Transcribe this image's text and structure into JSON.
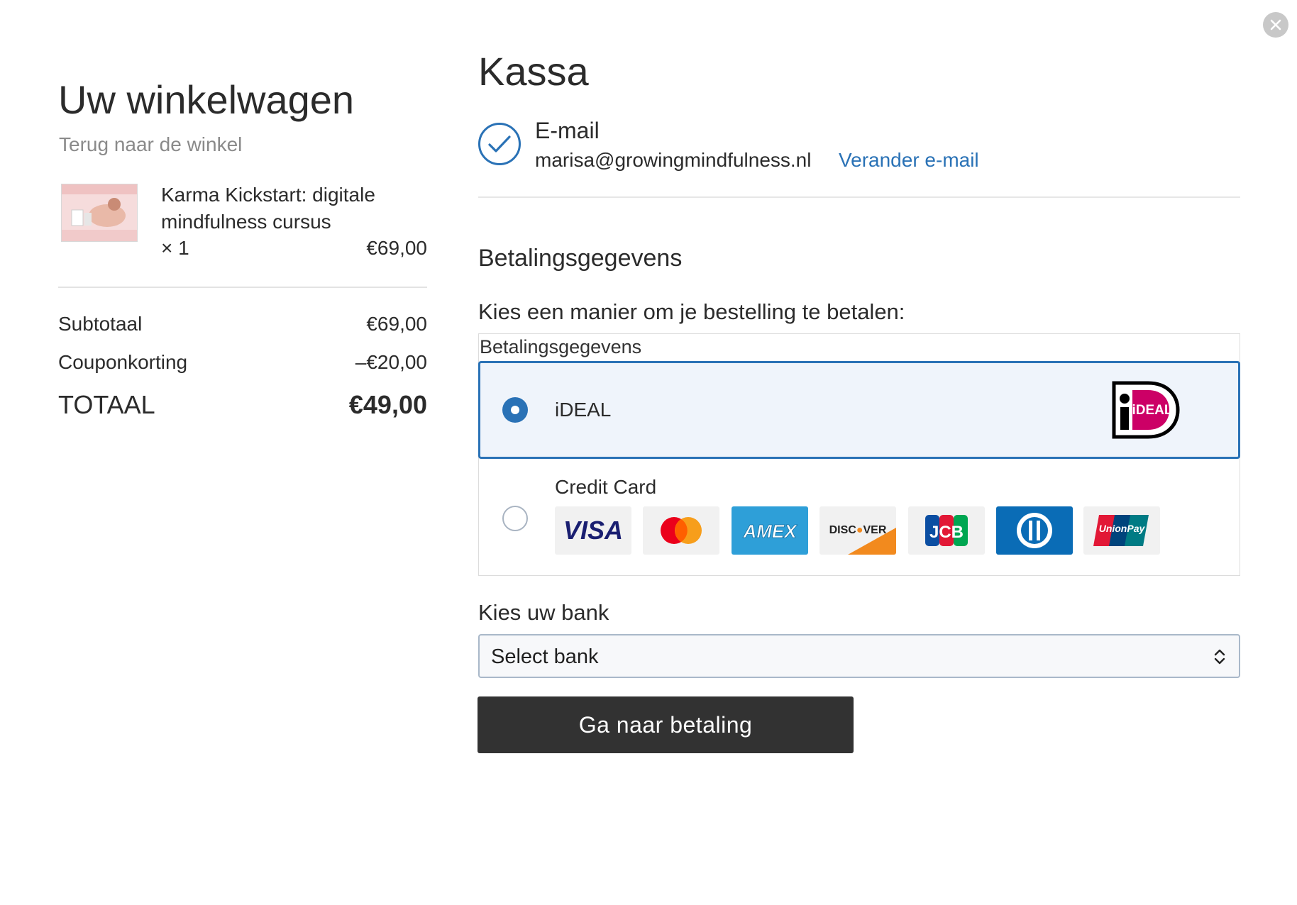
{
  "cart": {
    "title": "Uw winkelwagen",
    "back_link": "Terug naar de winkel",
    "item": {
      "name": "Karma Kickstart: digitale mindfulness cursus",
      "qty": "× 1",
      "price": "€69,00"
    },
    "summary": {
      "subtotal_label": "Subtotaal",
      "subtotal_value": "€69,00",
      "coupon_label": "Couponkorting",
      "coupon_value": "–€20,00",
      "total_label": "TOTAAL",
      "total_value": "€49,00"
    }
  },
  "checkout": {
    "title": "Kassa",
    "email_label": "E-mail",
    "email_value": "marisa@growingmindfulness.nl",
    "change_email": "Verander e-mail",
    "payment_heading": "Betalingsgegevens",
    "payment_prompt": "Kies een manier om je bestelling te betalen:",
    "methods_legend": "Betalingsgegevens",
    "methods": [
      {
        "label": "iDEAL",
        "selected": true
      },
      {
        "label": "Credit Card",
        "selected": false
      }
    ],
    "ideal_logo_text": "iDEAL",
    "cards": [
      "visa-icon",
      "mastercard-icon",
      "amex-icon",
      "discover-icon",
      "jcb-icon",
      "diners-club-icon",
      "unionpay-icon"
    ],
    "bank_heading": "Kies uw bank",
    "bank_select_value": "Select bank",
    "pay_button": "Ga naar betaling"
  },
  "colors": {
    "accent": "#2a72b6",
    "selected_bg": "#eff4fb",
    "button_bg": "#323232"
  }
}
